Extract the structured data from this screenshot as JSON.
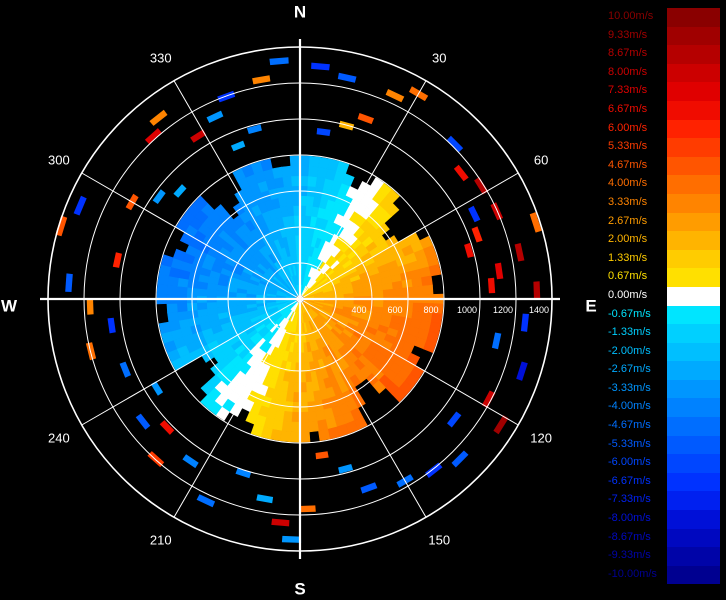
{
  "chart_data": {
    "type": "polar-radar",
    "compass": {
      "north": "N",
      "east": "E",
      "south": "S",
      "west": "W"
    },
    "bearing_labels": [
      {
        "deg": 30,
        "text": "30"
      },
      {
        "deg": 60,
        "text": "60"
      },
      {
        "deg": 120,
        "text": "120"
      },
      {
        "deg": 150,
        "text": "150"
      },
      {
        "deg": 210,
        "text": "210"
      },
      {
        "deg": 240,
        "text": "240"
      },
      {
        "deg": 300,
        "text": "300"
      },
      {
        "deg": 330,
        "text": "330"
      }
    ],
    "range_rings": [
      200,
      400,
      600,
      800,
      1000,
      1200,
      1400
    ],
    "range_labels": [
      {
        "value": 400,
        "text": "400"
      },
      {
        "value": 600,
        "text": "600"
      },
      {
        "value": 800,
        "text": "800"
      },
      {
        "value": 1000,
        "text": "1000"
      },
      {
        "value": 1200,
        "text": "1200"
      },
      {
        "value": 1400,
        "text": "1400"
      }
    ],
    "range_max": 1400,
    "spokes_deg_step": 30,
    "velocity_range": [
      -10,
      10
    ],
    "inner_approach_direction_deg": 300,
    "inner_data_extent": 790,
    "legend": {
      "unit": "m/s",
      "entries": [
        {
          "label": "10.00m/s",
          "color": "#8a0000"
        },
        {
          "label": "9.33m/s",
          "color": "#a00000"
        },
        {
          "label": "8.67m/s",
          "color": "#b50000"
        },
        {
          "label": "8.00m/s",
          "color": "#cc0000"
        },
        {
          "label": "7.33m/s",
          "color": "#e00000"
        },
        {
          "label": "6.67m/s",
          "color": "#f00c00"
        },
        {
          "label": "6.00m/s",
          "color": "#ff2200"
        },
        {
          "label": "5.33m/s",
          "color": "#ff3c00"
        },
        {
          "label": "4.67m/s",
          "color": "#ff5500"
        },
        {
          "label": "4.00m/s",
          "color": "#ff6e00"
        },
        {
          "label": "3.33m/s",
          "color": "#ff8400"
        },
        {
          "label": "2.67m/s",
          "color": "#ff9c00"
        },
        {
          "label": "2.00m/s",
          "color": "#ffb400"
        },
        {
          "label": "1.33m/s",
          "color": "#ffcc00"
        },
        {
          "label": "0.67m/s",
          "color": "#ffe000"
        },
        {
          "label": "0.00m/s",
          "color": "#ffffff"
        },
        {
          "label": "-0.67m/s",
          "color": "#00e5ff"
        },
        {
          "label": "-1.33m/s",
          "color": "#00d0ff"
        },
        {
          "label": "-2.00m/s",
          "color": "#00bfff"
        },
        {
          "label": "-2.67m/s",
          "color": "#00aaff"
        },
        {
          "label": "-3.33m/s",
          "color": "#0096ff"
        },
        {
          "label": "-4.00m/s",
          "color": "#0082ff"
        },
        {
          "label": "-4.67m/s",
          "color": "#006eff"
        },
        {
          "label": "-5.33m/s",
          "color": "#005aff"
        },
        {
          "label": "-6.00m/s",
          "color": "#0046ff"
        },
        {
          "label": "-6.67m/s",
          "color": "#0032ff"
        },
        {
          "label": "-7.33m/s",
          "color": "#0020f0"
        },
        {
          "label": "-8.00m/s",
          "color": "#0010d8"
        },
        {
          "label": "-8.67m/s",
          "color": "#0008c0"
        },
        {
          "label": "-9.33m/s",
          "color": "#0004a8"
        },
        {
          "label": "-10.00m/s",
          "color": "#000090"
        }
      ]
    },
    "scatter_cells": [
      {
        "az": 355,
        "r": 1310,
        "v": -4.7
      },
      {
        "az": 350,
        "r": 1220,
        "v": 3.3
      },
      {
        "az": 340,
        "r": 1180,
        "v": -6.7
      },
      {
        "az": 335,
        "r": 1100,
        "v": -3.3
      },
      {
        "az": 328,
        "r": 1050,
        "v": 8.0
      },
      {
        "az": 322,
        "r": 1260,
        "v": 3.3
      },
      {
        "az": 318,
        "r": 1200,
        "v": 7.3
      },
      {
        "az": 345,
        "r": 960,
        "v": -4.0
      },
      {
        "az": 338,
        "r": 900,
        "v": -2.7
      },
      {
        "az": 5,
        "r": 1280,
        "v": -6.7
      },
      {
        "az": 12,
        "r": 1240,
        "v": -5.3
      },
      {
        "az": 25,
        "r": 1230,
        "v": 3.3
      },
      {
        "az": 30,
        "r": 1300,
        "v": 4.0
      },
      {
        "az": 20,
        "r": 1050,
        "v": 4.7
      },
      {
        "az": 15,
        "r": 980,
        "v": 2.0
      },
      {
        "az": 8,
        "r": 920,
        "v": -6.0
      },
      {
        "az": 45,
        "r": 1200,
        "v": -6.0
      },
      {
        "az": 52,
        "r": 1120,
        "v": 6.7
      },
      {
        "az": 58,
        "r": 1170,
        "v": 8.7
      },
      {
        "az": 64,
        "r": 1060,
        "v": -6.7
      },
      {
        "az": 66,
        "r": 1180,
        "v": 8.0
      },
      {
        "az": 70,
        "r": 1030,
        "v": 6.0
      },
      {
        "az": 74,
        "r": 960,
        "v": 6.7
      },
      {
        "az": 78,
        "r": 1230,
        "v": 8.7
      },
      {
        "az": 82,
        "r": 1100,
        "v": 7.3
      },
      {
        "az": 86,
        "r": 1050,
        "v": 6.7
      },
      {
        "az": 88,
        "r": 1300,
        "v": 8.7
      },
      {
        "az": 72,
        "r": 1360,
        "v": 4.0
      },
      {
        "az": 96,
        "r": 1240,
        "v": -6.7
      },
      {
        "az": 102,
        "r": 1100,
        "v": -4.7
      },
      {
        "az": 108,
        "r": 1280,
        "v": -8.0
      },
      {
        "az": 118,
        "r": 1170,
        "v": 8.0
      },
      {
        "az": 122,
        "r": 1300,
        "v": 9.3
      },
      {
        "az": 128,
        "r": 1070,
        "v": -6.0
      },
      {
        "az": 135,
        "r": 1240,
        "v": -5.3
      },
      {
        "az": 142,
        "r": 1190,
        "v": -6.7
      },
      {
        "az": 150,
        "r": 1150,
        "v": -4.7
      },
      {
        "az": 160,
        "r": 1100,
        "v": -5.3
      },
      {
        "az": 165,
        "r": 960,
        "v": -3.3
      },
      {
        "az": 172,
        "r": 860,
        "v": 4.7
      },
      {
        "az": 178,
        "r": 1150,
        "v": 4.0
      },
      {
        "az": 182,
        "r": 1320,
        "v": -3.3
      },
      {
        "az": 185,
        "r": 1230,
        "v": 8.0
      },
      {
        "az": 190,
        "r": 1110,
        "v": -2.7
      },
      {
        "az": 198,
        "r": 1000,
        "v": -4.0
      },
      {
        "az": 205,
        "r": 1220,
        "v": -4.7
      },
      {
        "az": 214,
        "r": 1070,
        "v": -4.0
      },
      {
        "az": 222,
        "r": 1180,
        "v": 5.3
      },
      {
        "az": 226,
        "r": 1010,
        "v": 6.7
      },
      {
        "az": 232,
        "r": 1090,
        "v": -5.3
      },
      {
        "az": 238,
        "r": 920,
        "v": -3.3
      },
      {
        "az": 248,
        "r": 1030,
        "v": -4.7
      },
      {
        "az": 256,
        "r": 1180,
        "v": 4.0
      },
      {
        "az": 262,
        "r": 1040,
        "v": -6.7
      },
      {
        "az": 268,
        "r": 1150,
        "v": 3.3
      },
      {
        "az": 274,
        "r": 1270,
        "v": -5.3
      },
      {
        "az": 282,
        "r": 1020,
        "v": 6.0
      },
      {
        "az": 287,
        "r": 1370,
        "v": 4.7
      },
      {
        "az": 293,
        "r": 1310,
        "v": -6.7
      },
      {
        "az": 300,
        "r": 1060,
        "v": 4.7
      },
      {
        "az": 306,
        "r": 950,
        "v": -3.3
      },
      {
        "az": 312,
        "r": 880,
        "v": -2.7
      }
    ]
  }
}
